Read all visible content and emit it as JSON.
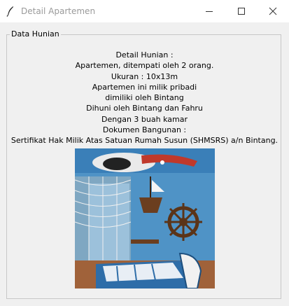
{
  "window": {
    "title": "Detail Apartemen",
    "icon": "feather-icon",
    "controls": [
      "minimize-icon",
      "maximize-icon",
      "close-icon"
    ]
  },
  "frame": {
    "label": "Data Hunian"
  },
  "details": {
    "lines": [
      "Detail Hunian :",
      "Apartemen, ditempati oleh 2 orang.",
      "Ukuran : 10x13m",
      "Apartemen ini milik pribadi",
      "dimiliki oleh Bintang",
      "Dihuni oleh Bintang dan Fahru",
      "Dengan 3 buah kamar",
      "Dokumen Bangunan :",
      "Sertifikat Hak Milik Atas Satuan Rumah Susun (SHMSRS) a/n Bintang."
    ]
  },
  "colors": {
    "titlebar": "#ffffff",
    "window_bg": "#f0f0f0",
    "frame_border": "#c7c7c7",
    "title_text": "#9a9a9a"
  }
}
